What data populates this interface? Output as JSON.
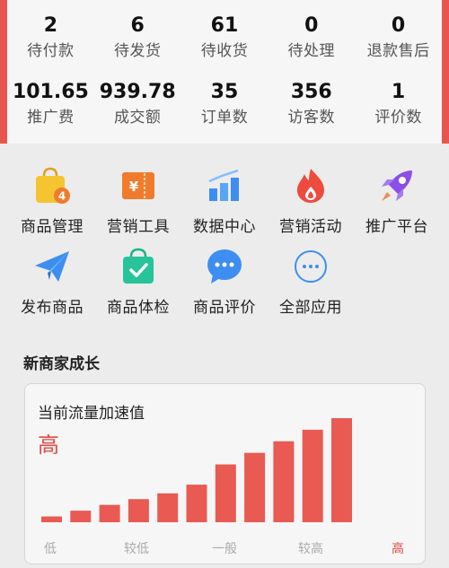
{
  "stats": {
    "row1": [
      {
        "value": "2",
        "label": "待付款"
      },
      {
        "value": "6",
        "label": "待发货"
      },
      {
        "value": "61",
        "label": "待收货"
      },
      {
        "value": "0",
        "label": "待处理"
      },
      {
        "value": "0",
        "label": "退款售后"
      }
    ],
    "row2": [
      {
        "value": "101.65",
        "label": "推广费"
      },
      {
        "value": "939.78",
        "label": "成交额"
      },
      {
        "value": "35",
        "label": "订单数"
      },
      {
        "value": "356",
        "label": "访客数"
      },
      {
        "value": "1",
        "label": "评价数"
      }
    ]
  },
  "apps": [
    {
      "label": "商品管理",
      "icon": "shopping-bag-icon",
      "badge": "4"
    },
    {
      "label": "营销工具",
      "icon": "coupon-icon",
      "badge": "¥"
    },
    {
      "label": "数据中心",
      "icon": "bar-chart-icon"
    },
    {
      "label": "营销活动",
      "icon": "flame-icon"
    },
    {
      "label": "推广平台",
      "icon": "rocket-icon"
    },
    {
      "label": "发布商品",
      "icon": "paper-plane-icon"
    },
    {
      "label": "商品体检",
      "icon": "checked-bag-icon"
    },
    {
      "label": "商品评价",
      "icon": "chat-bubble-icon"
    },
    {
      "label": "全部应用",
      "icon": "more-icon"
    }
  ],
  "growth": {
    "section_title": "新商家成长",
    "card_title": "当前流量加速值",
    "level": "高"
  },
  "colors": {
    "accent_red": "#e8554e",
    "bar_red": "#e85a52"
  },
  "chart_data": {
    "type": "bar",
    "title": "当前流量加速值",
    "categories": [
      "1",
      "2",
      "3",
      "4",
      "5",
      "6",
      "7",
      "8",
      "9",
      "10",
      "11"
    ],
    "values": [
      1,
      2,
      3,
      4,
      5,
      6.5,
      10,
      12,
      14,
      16,
      18
    ],
    "x_tick_labels": [
      "低",
      "较低",
      "一般",
      "较高",
      "高"
    ],
    "ylim": [
      0,
      18
    ],
    "highlight_tick": "高"
  }
}
